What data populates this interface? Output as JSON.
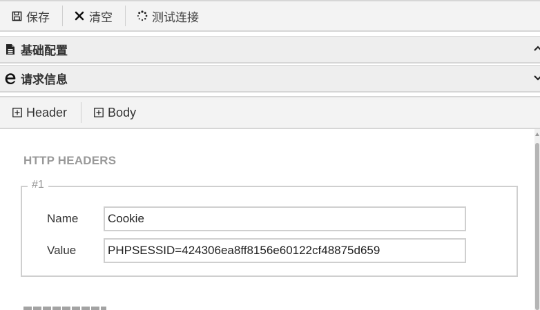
{
  "toolbar": {
    "save_label": "保存",
    "clear_label": "清空",
    "test_label": "测试连接"
  },
  "panels": {
    "basic_config": "基础配置",
    "request_info": "请求信息"
  },
  "subtabs": {
    "header": "Header",
    "body": "Body"
  },
  "headers_section": {
    "title": "HTTP HEADERS",
    "entries": [
      {
        "legend": "#1",
        "name_label": "Name",
        "value_label": "Value",
        "name_value": "Cookie",
        "value_value": "PHPSESSID=424306ea8ff8156e60122cf48875d659"
      }
    ]
  },
  "icons": {
    "save": "floppy-disk-icon",
    "clear": "x-mark-icon",
    "test": "spinner-icon",
    "basic_config": "document-icon",
    "request_info": "internet-explorer-icon",
    "expand": "plus-square-icon"
  }
}
